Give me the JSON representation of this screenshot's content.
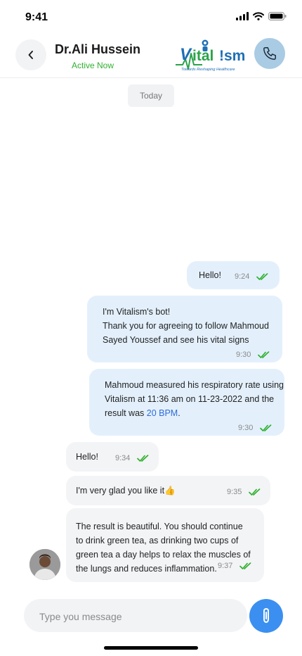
{
  "status_bar": {
    "time": "9:41"
  },
  "header": {
    "name": "Dr.Ali Hussein",
    "status": "Active Now",
    "logo_text": "Vitalism",
    "logo_tagline": "Towards Reshaping Healthcare"
  },
  "chat": {
    "date_label": "Today",
    "messages": [
      {
        "direction": "outgoing",
        "text": "Hello!",
        "time": "9:24"
      },
      {
        "direction": "outgoing",
        "text": "I'm Vitalism's bot!\nThank you for agreeing to follow Mahmoud\nSayed Youssef and see his vital signs",
        "time": "9:30"
      },
      {
        "direction": "outgoing",
        "text_before": "Mahmoud measured his respiratory rate using\nVitalism at 11:36 am on 11-23-2022 and the\nresult was ",
        "highlight": "20 BPM",
        "text_after": ".",
        "time": "9:30"
      },
      {
        "direction": "incoming",
        "text": "Hello!",
        "time": "9:34"
      },
      {
        "direction": "incoming",
        "text": "I'm very glad you like it👍",
        "time": "9:35"
      },
      {
        "direction": "incoming",
        "text": "The result is beautiful. You should continue\nto drink green tea, as drinking two cups of\ngreen tea a day helps to relax the muscles of\nthe lungs and reduces inflammation.",
        "time": "9:37"
      }
    ]
  },
  "composer": {
    "placeholder": "Type you message"
  },
  "colors": {
    "outgoing_bubble": "#e3f0fc",
    "incoming_bubble": "#f3f4f6",
    "read_check": "#2fb12f",
    "accent": "#3b8ff0",
    "active_status": "#2fb12f",
    "link": "#2e6bd8"
  },
  "icons": {
    "back": "chevron-left-icon",
    "call": "phone-icon",
    "attach": "paperclip-icon",
    "read": "double-check-icon"
  }
}
